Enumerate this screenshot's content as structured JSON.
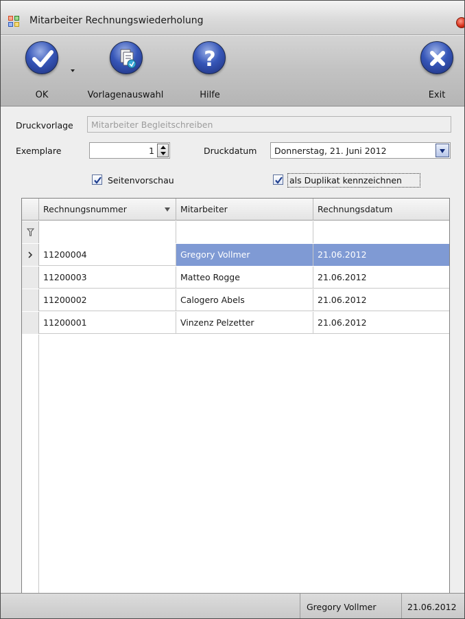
{
  "window": {
    "title": "Mitarbeiter Rechnungswiederholung"
  },
  "toolbar": {
    "ok_label": "OK",
    "template_label": "Vorlagenauswahl",
    "help_label": "Hilfe",
    "exit_label": "Exit"
  },
  "form": {
    "template_label": "Druckvorlage",
    "template_value": "Mitarbeiter Begleitschreiben",
    "copies_label": "Exemplare",
    "copies_value": "1",
    "print_date_label": "Druckdatum",
    "print_date_value": "Donnerstag, 21. Juni 2012",
    "preview_label": "Seitenvorschau",
    "preview_checked": true,
    "duplicate_label": "als Duplikat kennzeichnen",
    "duplicate_checked": true
  },
  "grid": {
    "columns": [
      "Rechnungsnummer",
      "Mitarbeiter",
      "Rechnungsdatum"
    ],
    "rows": [
      {
        "number": "11200004",
        "employee": "Gregory Vollmer",
        "date": "21.06.2012",
        "selected": true
      },
      {
        "number": "11200003",
        "employee": "Matteo Rogge",
        "date": "21.06.2012",
        "selected": false
      },
      {
        "number": "11200002",
        "employee": "Calogero Abels",
        "date": "21.06.2012",
        "selected": false
      },
      {
        "number": "11200001",
        "employee": "Vinzenz Pelzetter",
        "date": "21.06.2012",
        "selected": false
      }
    ]
  },
  "status": {
    "employee": "Gregory Vollmer",
    "date": "21.06.2012"
  },
  "colors": {
    "selection": "#7f9ad4",
    "icon_blue": "#3656b8"
  }
}
